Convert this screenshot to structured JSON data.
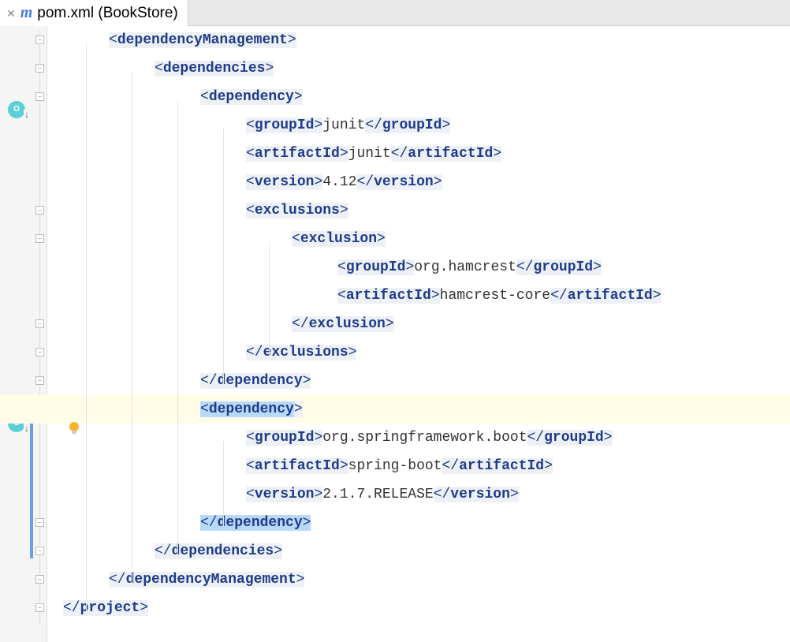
{
  "tab": {
    "label": "pom.xml (BookStore)"
  },
  "code": {
    "dependencyManagement_open": "dependencyManagement",
    "dependencies_open": "dependencies",
    "dependency_open": "dependency",
    "groupId": "groupId",
    "artifactId": "artifactId",
    "version": "version",
    "exclusions": "exclusions",
    "exclusion": "exclusion",
    "junit_group": "junit",
    "junit_artifact": "junit",
    "junit_version": "4.12",
    "hamcrest_group": "org.hamcrest",
    "hamcrest_artifact": "hamcrest-core",
    "spring_group": "org.springframework.boot",
    "spring_artifact": "spring-boot",
    "spring_version": "2.1.7.RELEASE",
    "project": "project"
  }
}
